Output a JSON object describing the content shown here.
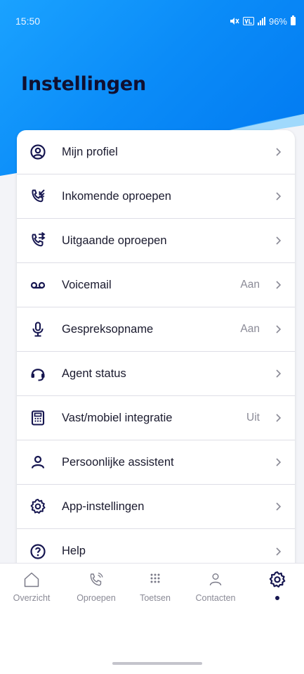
{
  "status_bar": {
    "time": "15:50",
    "battery_text": "96%",
    "mute_icon": "mute-icon",
    "network_icon": "volte-icon"
  },
  "page": {
    "title": "Instellingen"
  },
  "colors": {
    "brand_blue": "#0b8cf8",
    "icon_navy": "#161650",
    "value_gray": "#8a8a96"
  },
  "settings": {
    "items": [
      {
        "label": "Mijn profiel",
        "value": "",
        "icon": "profile-icon"
      },
      {
        "label": "Inkomende oproepen",
        "value": "",
        "icon": "incoming-call-icon"
      },
      {
        "label": "Uitgaande oproepen",
        "value": "",
        "icon": "outgoing-call-icon"
      },
      {
        "label": "Voicemail",
        "value": "Aan",
        "icon": "voicemail-icon"
      },
      {
        "label": "Gespreksopname",
        "value": "Aan",
        "icon": "microphone-icon"
      },
      {
        "label": "Agent status",
        "value": "",
        "icon": "headset-icon"
      },
      {
        "label": "Vast/mobiel integratie",
        "value": "Uit",
        "icon": "desk-phone-icon"
      },
      {
        "label": "Persoonlijke assistent",
        "value": "",
        "icon": "person-icon"
      },
      {
        "label": "App-instellingen",
        "value": "",
        "icon": "gear-icon"
      },
      {
        "label": "Help",
        "value": "",
        "icon": "help-icon"
      }
    ]
  },
  "bottom_nav": {
    "items": [
      {
        "label": "Overzicht",
        "icon": "home-icon"
      },
      {
        "label": "Oproepen",
        "icon": "phone-icon"
      },
      {
        "label": "Toetsen",
        "icon": "keypad-icon"
      },
      {
        "label": "Contacten",
        "icon": "contacts-icon"
      },
      {
        "label": "",
        "icon": "gear-icon",
        "active": true
      }
    ]
  }
}
